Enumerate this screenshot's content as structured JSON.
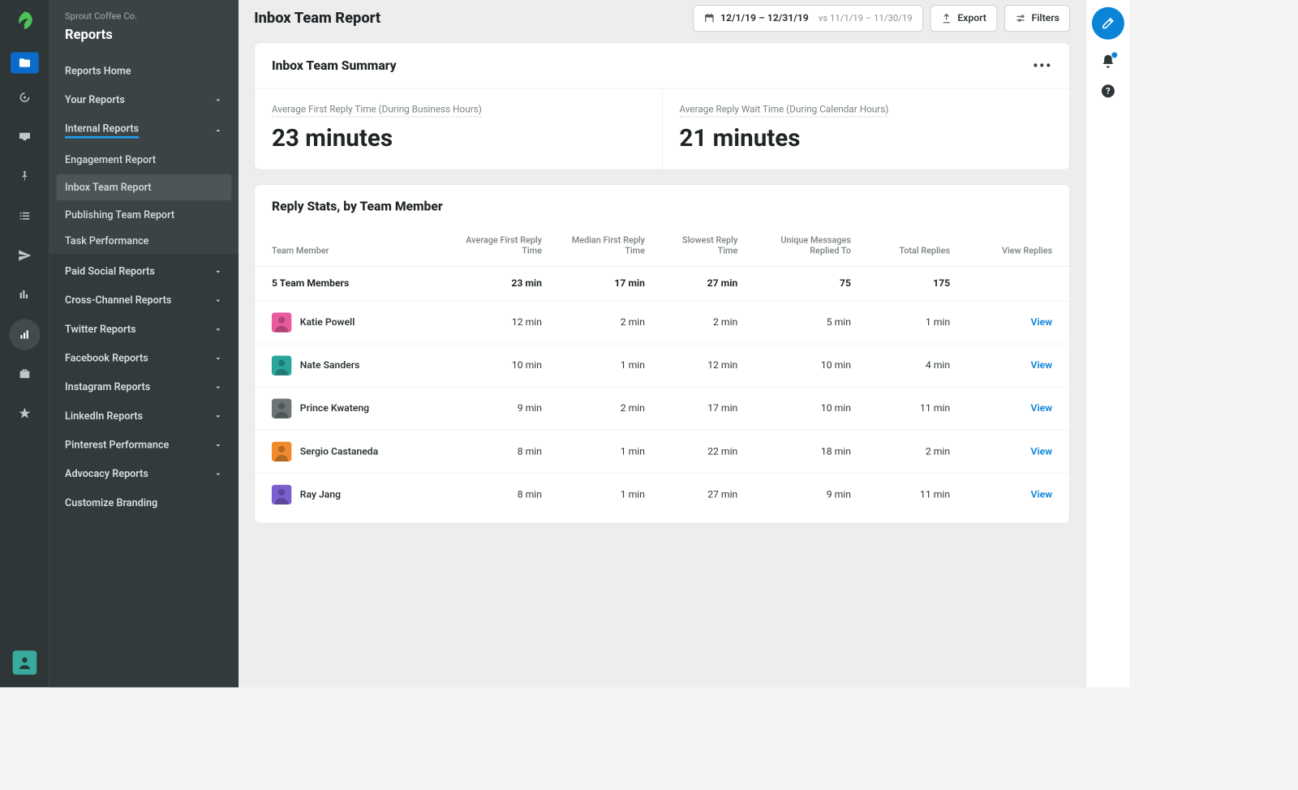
{
  "org": {
    "name": "Sprout Coffee Co.",
    "section": "Reports"
  },
  "sidebar": {
    "home": "Reports Home",
    "your": "Your Reports",
    "internal": "Internal Reports",
    "internal_items": [
      "Engagement Report",
      "Inbox Team Report",
      "Publishing Team Report",
      "Task Performance"
    ],
    "groups": [
      "Paid Social Reports",
      "Cross-Channel Reports",
      "Twitter Reports",
      "Facebook Reports",
      "Instagram Reports",
      "LinkedIn Reports",
      "Pinterest Performance",
      "Advocacy Reports"
    ],
    "customize": "Customize Branding"
  },
  "header": {
    "title": "Inbox Team Report",
    "date_range": "12/1/19 – 12/31/19",
    "compare_prefix": "vs",
    "compare_range": "11/1/19 – 11/30/19",
    "export": "Export",
    "filters": "Filters"
  },
  "summary": {
    "title": "Inbox Team Summary",
    "metric1_label": "Average First Reply Time (During Business Hours)",
    "metric1_value": "23 minutes",
    "metric2_label": "Average Reply Wait Time (During Calendar Hours)",
    "metric2_value": "21 minutes"
  },
  "table": {
    "title": "Reply Stats, by Team Member",
    "columns": [
      "Team Member",
      "Average First Reply Time",
      "Median First Reply Time",
      "Slowest Reply Time",
      "Unique Messages Replied To",
      "Total Replies",
      "View Replies"
    ],
    "totals": {
      "label": "5 Team Members",
      "c1": "23 min",
      "c2": "17 min",
      "c3": "27 min",
      "c4": "75",
      "c5": "175"
    },
    "rows": [
      {
        "name": "Katie Powell",
        "avatar": "#e85a9b",
        "c1": "12 min",
        "c2": "2 min",
        "c3": "2 min",
        "c4": "5 min",
        "c5": "1 min",
        "view": "View"
      },
      {
        "name": "Nate Sanders",
        "avatar": "#2aa59a",
        "c1": "10 min",
        "c2": "1 min",
        "c3": "12 min",
        "c4": "10 min",
        "c5": "4 min",
        "view": "View"
      },
      {
        "name": "Prince Kwateng",
        "avatar": "#6b7577",
        "c1": "9 min",
        "c2": "2 min",
        "c3": "17 min",
        "c4": "10 min",
        "c5": "11 min",
        "view": "View"
      },
      {
        "name": "Sergio Castaneda",
        "avatar": "#f08a2c",
        "c1": "8 min",
        "c2": "1 min",
        "c3": "22 min",
        "c4": "18 min",
        "c5": "2 min",
        "view": "View"
      },
      {
        "name": "Ray Jang",
        "avatar": "#7a5fcf",
        "c1": "8 min",
        "c2": "1 min",
        "c3": "27 min",
        "c4": "9 min",
        "c5": "11 min",
        "view": "View"
      }
    ]
  }
}
